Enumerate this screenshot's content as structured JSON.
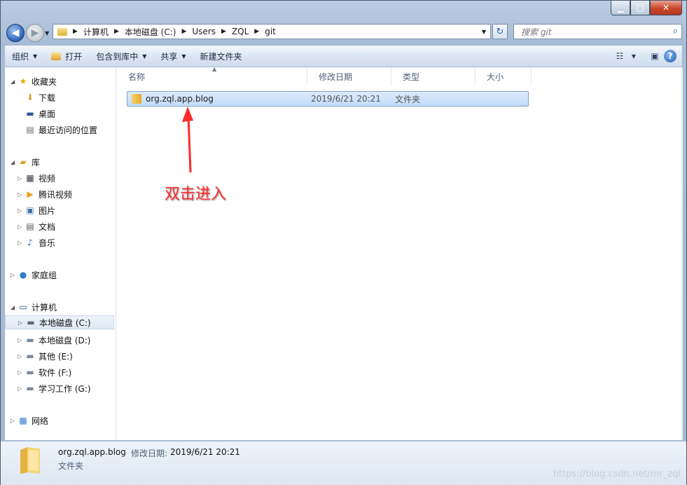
{
  "titlebar": {
    "minimize": "▁",
    "maximize": "□",
    "close": "✕"
  },
  "nav": {
    "back_glyph": "◀",
    "forward_glyph": "▶",
    "refresh_glyph": "↻"
  },
  "address": {
    "crumbs": [
      "计算机",
      "本地磁盘 (C:)",
      "Users",
      "ZQL",
      "git"
    ]
  },
  "search": {
    "placeholder": "搜索 git",
    "icon": "search-icon"
  },
  "toolbar": {
    "organize": "组织",
    "open": "打开",
    "include_in_library": "包含到库中",
    "share": "共享",
    "new_folder": "新建文件夹"
  },
  "navpane": {
    "favorites": {
      "label": "收藏夹",
      "items": [
        "下载",
        "桌面",
        "最近访问的位置"
      ]
    },
    "libraries": {
      "label": "库",
      "items": [
        "视频",
        "腾讯视频",
        "图片",
        "文档",
        "音乐"
      ]
    },
    "homegroup": {
      "label": "家庭组"
    },
    "computer": {
      "label": "计算机",
      "items": [
        "本地磁盘 (C:)",
        "本地磁盘 (D:)",
        "其他 (E:)",
        "软件 (F:)",
        "学习工作 (G:)"
      ]
    },
    "network": {
      "label": "网络"
    }
  },
  "columns": {
    "name": "名称",
    "modified": "修改日期",
    "type": "类型",
    "size": "大小"
  },
  "files": [
    {
      "name": "org.zql.app.blog",
      "modified": "2019/6/21 20:21",
      "type": "文件夹",
      "size": ""
    }
  ],
  "annotation": {
    "text": "双击进入",
    "color": "#ff2a2a"
  },
  "status": {
    "name": "org.zql.app.blog",
    "date_label": "修改日期:",
    "date": "2019/6/21 20:21",
    "type": "文件夹"
  },
  "watermark": "https://blog.csdn.net/mr_zql"
}
